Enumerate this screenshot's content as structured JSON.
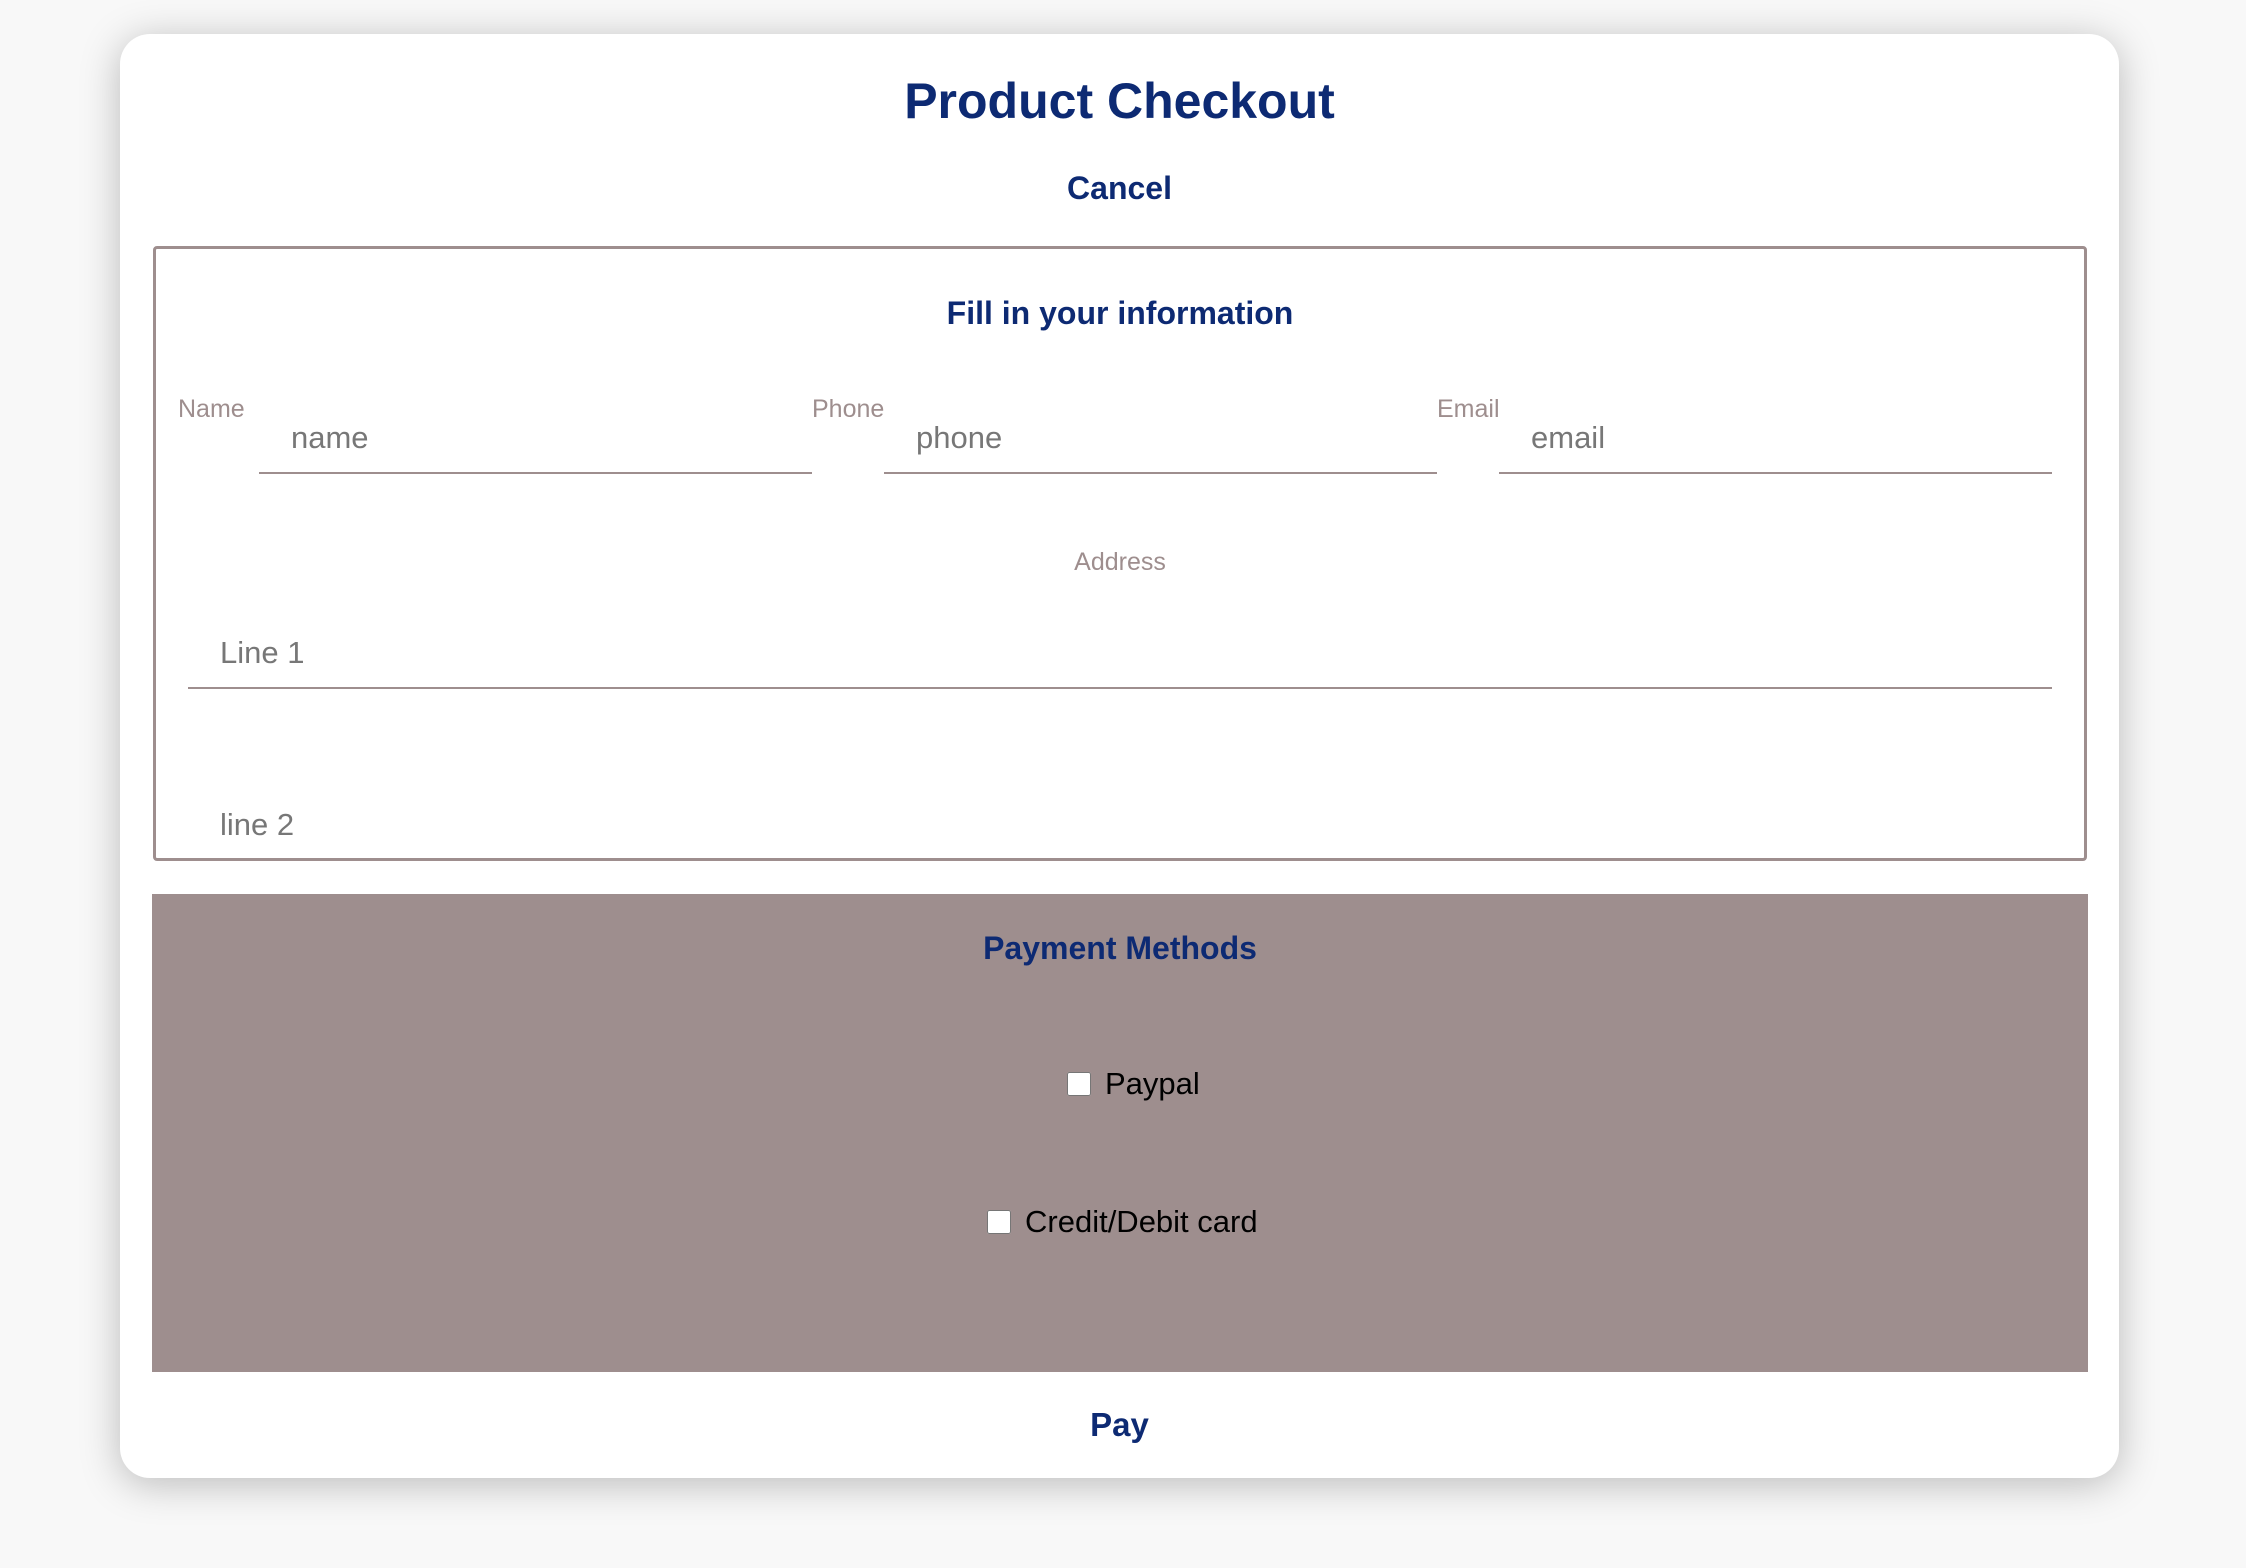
{
  "header": {
    "title": "Product Checkout",
    "cancel_label": "Cancel"
  },
  "info": {
    "heading": "Fill in your information",
    "name": {
      "label": "Name",
      "placeholder": "name"
    },
    "phone": {
      "label": "Phone",
      "placeholder": "phone"
    },
    "email": {
      "label": "Email",
      "placeholder": "email"
    },
    "address": {
      "label": "Address",
      "line1_placeholder": "Line 1",
      "line2_placeholder": "line 2"
    }
  },
  "payment": {
    "heading": "Payment Methods",
    "options": [
      {
        "label": "Paypal",
        "checked": false
      },
      {
        "label": "Credit/Debit card",
        "checked": false
      }
    ]
  },
  "footer": {
    "pay_label": "Pay"
  },
  "colors": {
    "accent": "#0d2a73",
    "muted": "#9e8e8e",
    "background": "#f8f8f8"
  }
}
